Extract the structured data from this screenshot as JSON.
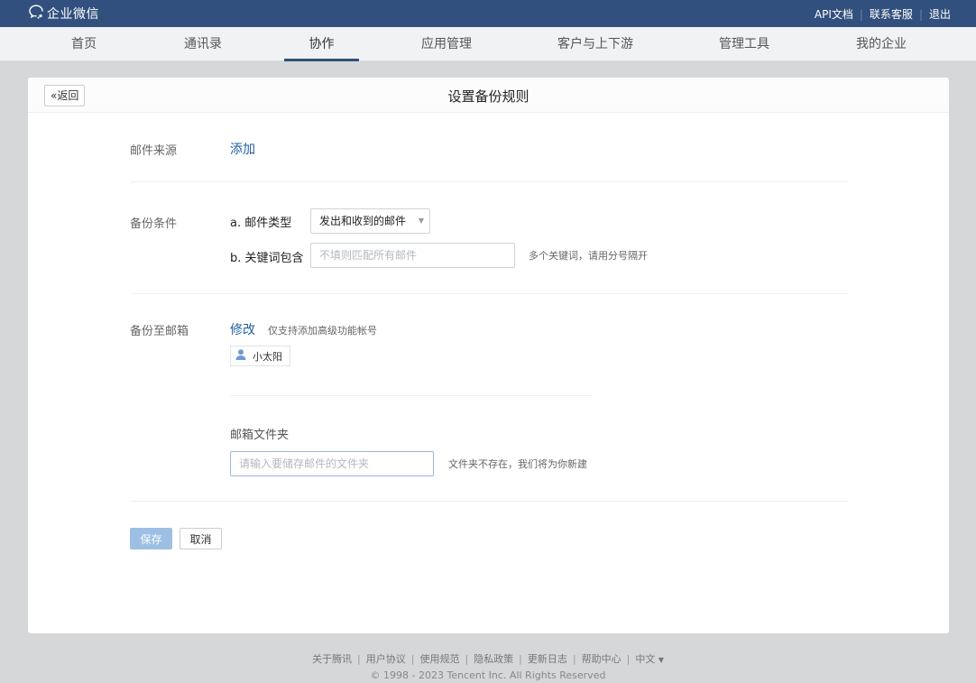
{
  "topbar": {
    "logo_text": "企业微信",
    "links": [
      "API文档",
      "联系客服",
      "退出"
    ]
  },
  "nav": {
    "items": [
      {
        "label": "首页"
      },
      {
        "label": "通讯录"
      },
      {
        "label": "协作",
        "active": true
      },
      {
        "label": "应用管理"
      },
      {
        "label": "客户与上下游"
      },
      {
        "label": "管理工具"
      },
      {
        "label": "我的企业"
      }
    ]
  },
  "panel": {
    "back_label": "返回",
    "title": "设置备份规则"
  },
  "form": {
    "source_label": "邮件来源",
    "source_action": "添加",
    "condition_label": "备份条件",
    "mail_type_label": "a. 邮件类型",
    "mail_type_value": "发出和收到的邮件",
    "keyword_label": "b. 关键词包含",
    "keyword_placeholder": "不填则匹配所有邮件",
    "keyword_hint": "多个关键词，请用分号隔开",
    "backup_to_label": "备份至邮箱",
    "modify_action": "修改",
    "modify_hint": "仅支持添加高级功能帐号",
    "member_name": "小太阳",
    "folder_label": "邮箱文件夹",
    "folder_placeholder": "请输入要储存邮件的文件夹",
    "folder_hint": "文件夹不存在，我们将为你新建",
    "save_label": "保存",
    "cancel_label": "取消"
  },
  "footer": {
    "links": [
      "关于腾讯",
      "用户协议",
      "使用规范",
      "隐私政策",
      "更新日志",
      "帮助中心",
      "中文"
    ],
    "copyright": "© 1998 - 2023 Tencent Inc. All Rights Reserved"
  },
  "colors": {
    "topbar": "#32507d",
    "link": "#1f5fa3",
    "save_button": "#9dbfe3"
  },
  "icons": [
    "wecom-logo-icon",
    "double-chevron-left-icon",
    "caret-down-icon",
    "user-icon"
  ]
}
